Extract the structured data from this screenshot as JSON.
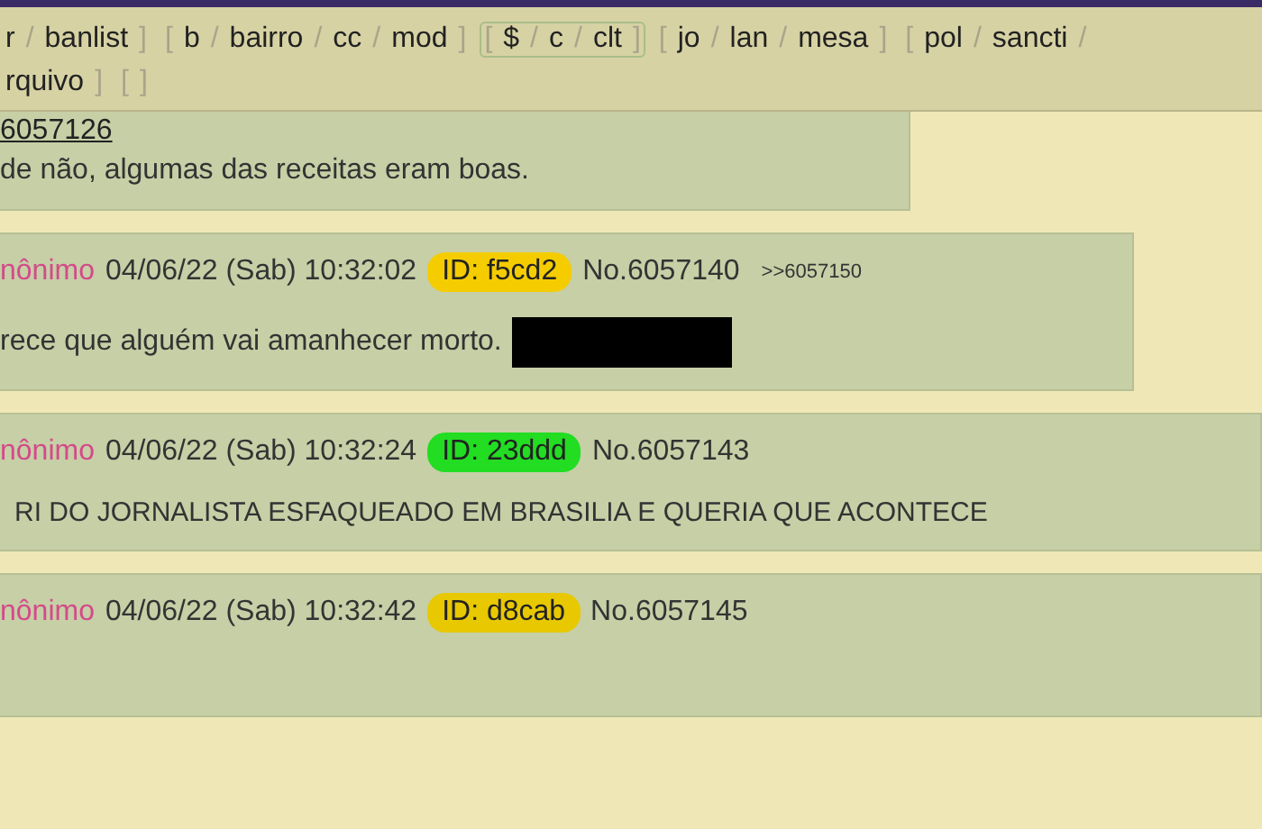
{
  "nav": {
    "lines": [
      {
        "groups": [
          {
            "selected": false,
            "tokens": [
              {
                "kind": "link",
                "text": "r"
              },
              {
                "kind": "punct",
                "text": "/"
              },
              {
                "kind": "link",
                "text": "banlist"
              },
              {
                "kind": "punct",
                "text": "]"
              }
            ]
          },
          {
            "selected": false,
            "tokens": [
              {
                "kind": "punct",
                "text": "["
              },
              {
                "kind": "link",
                "text": "b"
              },
              {
                "kind": "punct",
                "text": "/"
              },
              {
                "kind": "link",
                "text": "bairro"
              },
              {
                "kind": "punct",
                "text": "/"
              },
              {
                "kind": "link",
                "text": "cc"
              },
              {
                "kind": "punct",
                "text": "/"
              },
              {
                "kind": "link",
                "text": "mod"
              },
              {
                "kind": "punct",
                "text": "]"
              }
            ]
          },
          {
            "selected": true,
            "tokens": [
              {
                "kind": "punct",
                "text": "["
              },
              {
                "kind": "link",
                "text": "$"
              },
              {
                "kind": "punct",
                "text": "/"
              },
              {
                "kind": "link",
                "text": "c"
              },
              {
                "kind": "punct",
                "text": "/"
              },
              {
                "kind": "link",
                "text": "clt"
              },
              {
                "kind": "punct",
                "text": "]"
              }
            ]
          },
          {
            "selected": false,
            "tokens": [
              {
                "kind": "punct",
                "text": "["
              },
              {
                "kind": "link",
                "text": "jo"
              },
              {
                "kind": "punct",
                "text": "/"
              },
              {
                "kind": "link",
                "text": "lan"
              },
              {
                "kind": "punct",
                "text": "/"
              },
              {
                "kind": "link",
                "text": "mesa"
              },
              {
                "kind": "punct",
                "text": "]"
              }
            ]
          },
          {
            "selected": false,
            "tokens": [
              {
                "kind": "punct",
                "text": "["
              },
              {
                "kind": "link",
                "text": "pol"
              },
              {
                "kind": "punct",
                "text": "/"
              },
              {
                "kind": "link",
                "text": "sancti"
              },
              {
                "kind": "punct",
                "text": "/"
              }
            ]
          }
        ]
      },
      {
        "groups": [
          {
            "selected": false,
            "tokens": [
              {
                "kind": "link",
                "text": "rquivo"
              },
              {
                "kind": "punct",
                "text": "]"
              }
            ]
          },
          {
            "selected": false,
            "tokens": [
              {
                "kind": "punct",
                "text": "["
              },
              {
                "kind": "punct",
                "text": "]"
              }
            ]
          }
        ]
      }
    ]
  },
  "posts": [
    {
      "quote": "6057126",
      "body": "de não, algumas das receitas eram boas."
    },
    {
      "name": "nônimo",
      "date": "04/06/22 (Sab) 10:32:02",
      "id": "ID: f5cd2",
      "color": "#f5cc00",
      "number": "No.6057140",
      "backlink": ">>6057150",
      "body": "rece que alguém vai amanhecer morto.",
      "spoiler": true
    },
    {
      "name": "nônimo",
      "date": "04/06/22 (Sab) 10:32:24",
      "id": "ID: 23ddd",
      "color": "#22dd22",
      "number": "No.6057143",
      "body": "RI DO JORNALISTA ESFAQUEADO EM BRASILIA E QUERIA QUE ACONTECE"
    },
    {
      "name": "nônimo",
      "date": "04/06/22 (Sab) 10:32:42",
      "id": "ID: d8cab",
      "color": "#e8c800",
      "number": "No.6057145"
    }
  ]
}
